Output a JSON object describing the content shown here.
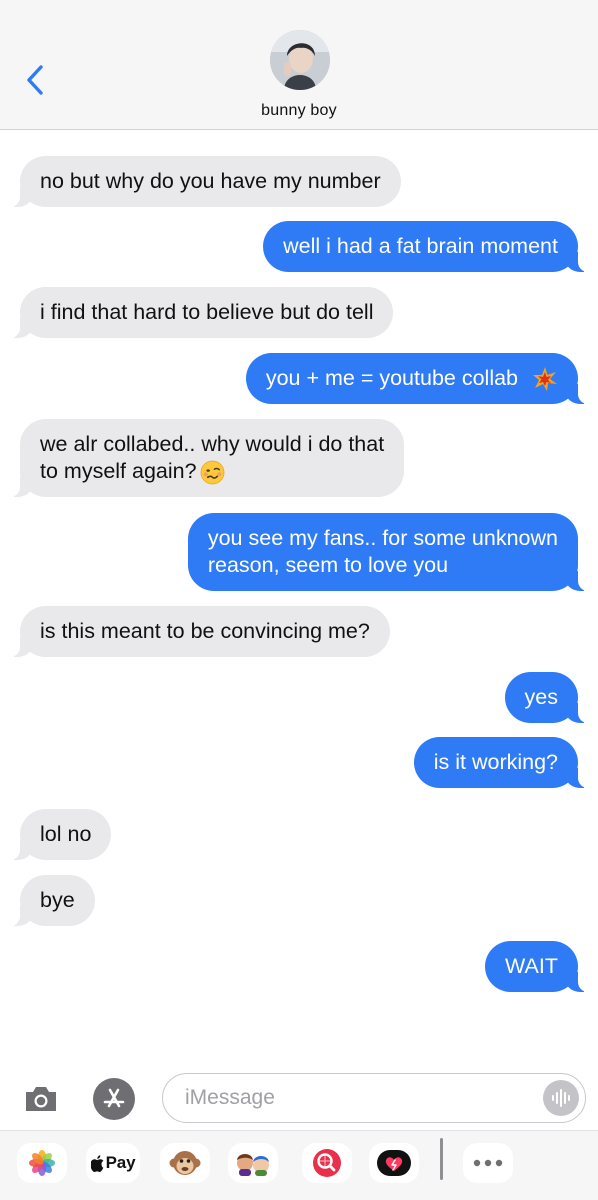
{
  "header": {
    "contact_name": "bunny boy",
    "accent_color": "#2f7bf5"
  },
  "messages": [
    {
      "side": "incoming",
      "text": "no but why do you have my number"
    },
    {
      "side": "outgoing",
      "text": "well i had a fat brain moment"
    },
    {
      "side": "incoming",
      "text": "i find that hard to believe but do tell"
    },
    {
      "side": "outgoing",
      "text": "you + me = youtube collab",
      "emoji": "collision-icon"
    },
    {
      "side": "incoming",
      "line1": "we alr collabed.. why would i do that",
      "line2": "to myself again?",
      "emoji": "woozy-face-icon"
    },
    {
      "side": "outgoing",
      "line1": "you see my fans.. for some unknown",
      "line2": "reason, seem to love you"
    },
    {
      "side": "incoming",
      "text": "is this meant to be convincing me?"
    },
    {
      "side": "outgoing",
      "text": "yes"
    },
    {
      "side": "outgoing",
      "text": "is it working?"
    },
    {
      "side": "incoming",
      "text": "lol no"
    },
    {
      "side": "incoming",
      "text": "bye"
    },
    {
      "side": "outgoing",
      "text": "WAIT"
    }
  ],
  "composer": {
    "placeholder": "iMessage"
  },
  "app_drawer": {
    "apple_pay_label": "Pay",
    "items": [
      "photos-icon",
      "apple-pay-icon",
      "monkey-memoji-icon",
      "memoji-stickers-icon",
      "web-search-icon",
      "digital-touch-icon",
      "more-icon"
    ]
  }
}
